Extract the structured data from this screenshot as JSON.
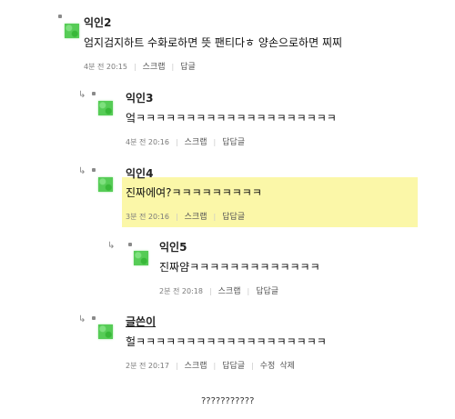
{
  "comments": [
    {
      "author": "익인2",
      "text": "엄지검지하트 수화로하면 뜻 팬티다ㅎ 양손으로하면 찌찌",
      "meta_time": "4분 전 20:15",
      "scrap": "스크랩",
      "reply": "답글"
    },
    {
      "author": "익인3",
      "text": "엌ㅋㅋㅋㅋㅋㅋㅋㅋㅋㅋㅋㅋㅋㅋㅋㅋㅋㅋㅋㅋ",
      "meta_time": "4분 전 20:16",
      "scrap": "스크랩",
      "reply": "답답글"
    },
    {
      "author": "익인4",
      "text": "진짜에여?ㅋㅋㅋㅋㅋㅋㅋㅋㅋ",
      "meta_time": "3분 전 20:16",
      "scrap": "스크랩",
      "reply": "답답글"
    },
    {
      "author": "익인5",
      "text": "진짜얌ㅋㅋㅋㅋㅋㅋㅋㅋㅋㅋㅋㅋㅋ",
      "meta_time": "2분 전 20:18",
      "scrap": "스크랩",
      "reply": "답답글"
    },
    {
      "author": "글쓴이",
      "text": "헐ㅋㅋㅋㅋㅋㅋㅋㅋㅋㅋㅋㅋㅋㅋㅋㅋㅋㅋㅋ",
      "meta_time": "2분 전 20:17",
      "scrap": "스크랩",
      "reply": "답답글",
      "edit": "수정",
      "delete": "삭제"
    }
  ],
  "footer": "???????????",
  "colors": {
    "highlight": "#fbf7a8",
    "avatar": "#56cc56"
  }
}
